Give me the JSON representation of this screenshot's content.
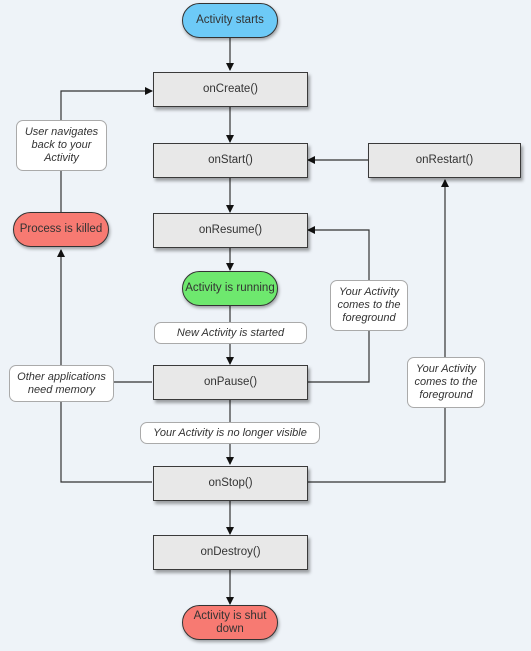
{
  "colors": {
    "background": "#eef3f8",
    "start": "#6dcaf7",
    "running": "#6ee86e",
    "killed": "#f77a72",
    "shutdown": "#f77a72",
    "process_box": "#e8e8e8"
  },
  "terminals": {
    "activity_starts": "Activity starts",
    "activity_running": "Activity is running",
    "process_killed": "Process is killed",
    "activity_shut_down": "Activity is shut down"
  },
  "callbacks": {
    "on_create": "onCreate()",
    "on_start": "onStart()",
    "on_restart": "onRestart()",
    "on_resume": "onResume()",
    "on_pause": "onPause()",
    "on_stop": "onStop()",
    "on_destroy": "onDestroy()"
  },
  "notes": {
    "user_navigates_back": "User navigates back to your Activity",
    "new_activity_started": "New Activity is started",
    "other_apps_need_memory": "Other applications need memory",
    "no_longer_visible": "Your Activity is no longer visible",
    "comes_to_foreground_1": "Your Activity comes to the foreground",
    "comes_to_foreground_2": "Your Activity comes to the foreground"
  }
}
